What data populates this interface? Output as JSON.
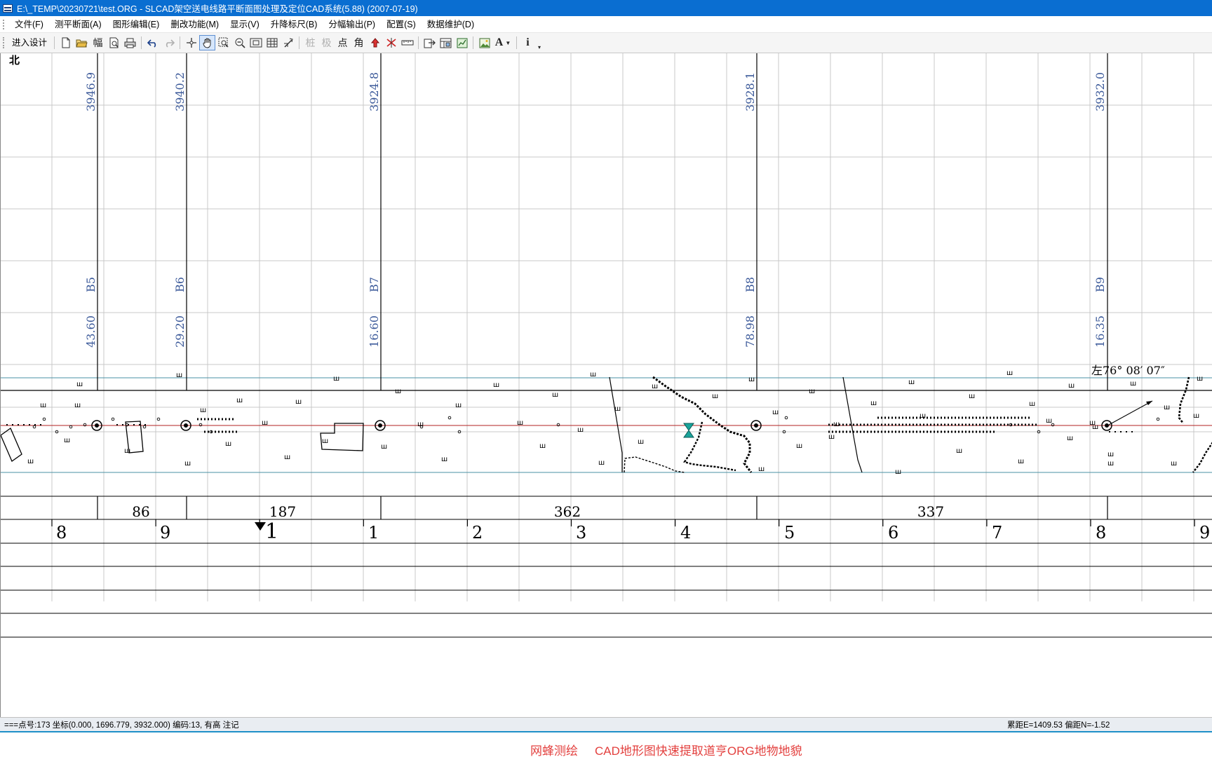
{
  "window": {
    "title": "E:\\_TEMP\\20230721\\test.ORG - SLCAD架空送电线路平断面图处理及定位CAD系统(5.88) (2007-07-19)"
  },
  "menu": [
    {
      "label": "文件(F)"
    },
    {
      "label": "测平断面(A)"
    },
    {
      "label": "图形编辑(E)"
    },
    {
      "label": "删改功能(M)"
    },
    {
      "label": "显示(V)"
    },
    {
      "label": "升降标尺(B)"
    },
    {
      "label": "分幅输出(P)"
    },
    {
      "label": "配置(S)"
    },
    {
      "label": "数据维护(D)"
    }
  ],
  "toolbar": {
    "enter_design": "进入设计",
    "glyph_frame": "幅",
    "glyph_stake": "桩",
    "glyph_pole": "极",
    "glyph_point": "点",
    "glyph_angle": "角",
    "glyph_font": "A",
    "glyph_info": "i",
    "icons": [
      "new-file-icon",
      "open-folder-icon",
      "frame-icon",
      "print-preview-icon",
      "print-icon",
      "undo-icon",
      "redo-icon",
      "crosshair-icon",
      "pan-hand-icon",
      "zoom-window-icon",
      "zoom-out-icon",
      "zoom-extents-icon",
      "grid-icon",
      "redraw-icon",
      "stake-icon",
      "pole-icon",
      "point-icon",
      "angle-icon",
      "raise-icon",
      "cross-icon",
      "ruler-icon",
      "export-icon",
      "table-icon",
      "chart-icon",
      "image-icon",
      "font-icon",
      "info-icon"
    ]
  },
  "drawing": {
    "north_label": "北",
    "towers": [
      {
        "elevation": "3946.9",
        "name": "B5",
        "height": "43.60"
      },
      {
        "elevation": "3940.2",
        "name": "B6",
        "height": "29.20"
      },
      {
        "elevation": "3924.8",
        "name": "B7",
        "height": "16.60"
      },
      {
        "elevation": "3928.1",
        "name": "B8",
        "height": "78.98"
      },
      {
        "elevation": "3932.0",
        "name": "B9",
        "height": "16.35"
      }
    ],
    "angle_label": "左76° 08′ 07″",
    "spans": [
      "86",
      "187",
      "362",
      "337"
    ],
    "mileage_ticks": [
      "8",
      "9",
      "1",
      "1",
      "2",
      "3",
      "4",
      "5",
      "6",
      "7",
      "8",
      "9"
    ],
    "colors": {
      "grid": "#c8c8c8",
      "tower_text": "#3c5a9a",
      "center_line": "#b22222",
      "corridor": "#4a90a4",
      "marker": "#1aa39a"
    }
  },
  "status": {
    "left": "===点号:173 坐标(0.000, 1696.779, 3932.000) 编码:13, 有高 注记",
    "right": "累距E=1409.53 偏距N=-1.52"
  },
  "caption": {
    "left": "网蜂测绘",
    "right": "CAD地形图快速提取道亨ORG地物地貌"
  }
}
